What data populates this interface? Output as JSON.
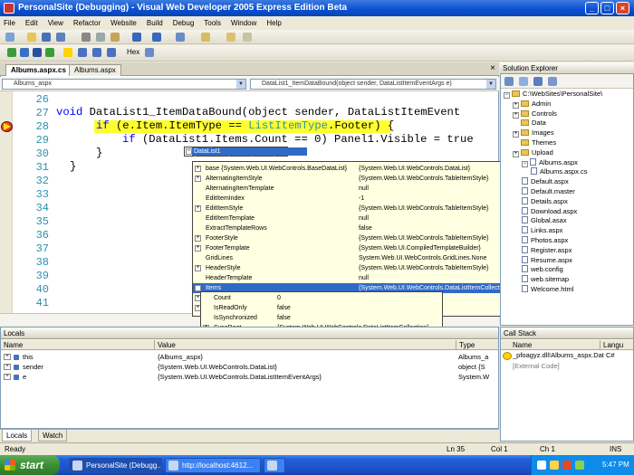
{
  "title_bar": {
    "text": "PersonalSite (Debugging) - Visual Web Developer 2005 Express Edition Beta",
    "min": "_",
    "max": "□",
    "close": "×"
  },
  "menu": [
    "File",
    "Edit",
    "View",
    "Refactor",
    "Website",
    "Build",
    "Debug",
    "Tools",
    "Window",
    "Help"
  ],
  "toolbar": {
    "hex_label": "Hex"
  },
  "doc_tabs": [
    "Albums.aspx.cs",
    "Albums.aspx"
  ],
  "combos": {
    "left": "Albums_aspx",
    "right": "DataList1_ItemDataBound(object sender, DataListItemEventArgs e)"
  },
  "code": {
    "line_numbers": [
      "26",
      "27",
      "28",
      "29",
      "30",
      "31",
      "32",
      "33",
      "34",
      "35",
      "36",
      "37",
      "38",
      "39",
      "40",
      "41"
    ],
    "line27_kw": "void",
    "line27_rest": " DataList1_ItemDataBound(object sender, DataListItemEvent",
    "line28_kw": "if",
    "line28_a": " (e.Item.ItemType == ",
    "line28_ty": "ListItemType",
    "line28_b": ".Footer) {",
    "line29_kw": "if",
    "line29_rest": " (DataList1.Items.Count == 0) Panel1.Visible = true",
    "line30": "}",
    "line31": "}"
  },
  "datatip": {
    "header_name": "DataList1",
    "header_value": "{System.Web.UI.WebControls.DataList}",
    "rows": [
      {
        "pm": "+",
        "name": "base {System.Web.UI.WebControls.BaseDataList}",
        "value": "{System.Web.UI.WebControls.DataList}"
      },
      {
        "pm": "+",
        "name": "AlternatingItemStyle",
        "value": "{System.Web.UI.WebControls.TableItemStyle}"
      },
      {
        "pm": "",
        "name": "AlternatingItemTemplate",
        "value": "null"
      },
      {
        "pm": "",
        "name": "EditItemIndex",
        "value": "-1"
      },
      {
        "pm": "+",
        "name": "EditItemStyle",
        "value": "{System.Web.UI.WebControls.TableItemStyle}"
      },
      {
        "pm": "",
        "name": "EditItemTemplate",
        "value": "null"
      },
      {
        "pm": "",
        "name": "ExtractTemplateRows",
        "value": "false"
      },
      {
        "pm": "+",
        "name": "FooterStyle",
        "value": "{System.Web.UI.WebControls.TableItemStyle}"
      },
      {
        "pm": "+",
        "name": "FooterTemplate",
        "value": "{System.Web.UI.CompiledTemplateBuilder}"
      },
      {
        "pm": "",
        "name": "GridLines",
        "value": "System.Web.UI.WebControls.GridLines.None"
      },
      {
        "pm": "+",
        "name": "HeaderStyle",
        "value": "{System.Web.UI.WebControls.TableItemStyle}"
      },
      {
        "pm": "",
        "name": "HeaderTemplate",
        "value": "null"
      },
      {
        "pm": "-",
        "name": "Items",
        "value": "{System.Web.UI.WebControls.DataListItemCollection}"
      },
      {
        "pm": "+",
        "name": "",
        "value": ""
      },
      {
        "pm": "+",
        "name": "",
        "value": "TemplateBuilder}"
      }
    ],
    "items_rows": [
      {
        "pm": "",
        "name": "Count",
        "value": "0"
      },
      {
        "pm": "",
        "name": "IsReadOnly",
        "value": "false"
      },
      {
        "pm": "",
        "name": "IsSynchronized",
        "value": "false"
      },
      {
        "pm": "+",
        "name": "SyncRoot",
        "value": "{System.Web.UI.WebControls.DataListItemCollection}"
      },
      {
        "pm": "+",
        "name": "Non-Public members",
        "value": ""
      }
    ]
  },
  "solution": {
    "title": "Solution Explorer",
    "root": "C:\\WebSites\\PersonalSite\\",
    "folders": [
      "Admin",
      "Controls",
      "Data",
      "Images",
      "Themes",
      "Upload"
    ],
    "files": [
      "Albums.aspx",
      "Albums.aspx.cs",
      "Default.aspx",
      "Default.master",
      "Details.aspx",
      "Download.aspx",
      "Global.asax",
      "Links.aspx",
      "Photos.aspx",
      "Register.aspx",
      "Resume.aspx",
      "web.config",
      "web.sitemap",
      "Welcome.html"
    ]
  },
  "locals": {
    "title": "Locals",
    "headers": [
      "Name",
      "Value",
      "Type"
    ],
    "rows": [
      {
        "name": "this",
        "value": "{Albums_aspx}",
        "type": "Albums_a"
      },
      {
        "name": "sender",
        "value": "{System.Web.UI.WebControls.DataList}",
        "type": "object {S"
      },
      {
        "name": "e",
        "value": "{System.Web.UI.WebControls.DataListItemEventArgs}",
        "type": "System.W"
      }
    ]
  },
  "bottom_tabs": [
    "Locals",
    "Watch"
  ],
  "callstack": {
    "title": "Call Stack",
    "headers": [
      "Name",
      "Langu"
    ],
    "row1": "_pfoagyz.dll!Albums_aspx.Dat C#",
    "row2": "[External Code]"
  },
  "status": {
    "ready": "Ready",
    "ln": "Ln 35",
    "col": "Col 1",
    "ch": "Ch 1",
    "ins": "INS"
  },
  "taskbar": {
    "start": "start",
    "tasks": [
      "PersonalSite (Debugg...",
      "http://localhost:4612...",
      ""
    ],
    "time": "5:47 PM"
  }
}
